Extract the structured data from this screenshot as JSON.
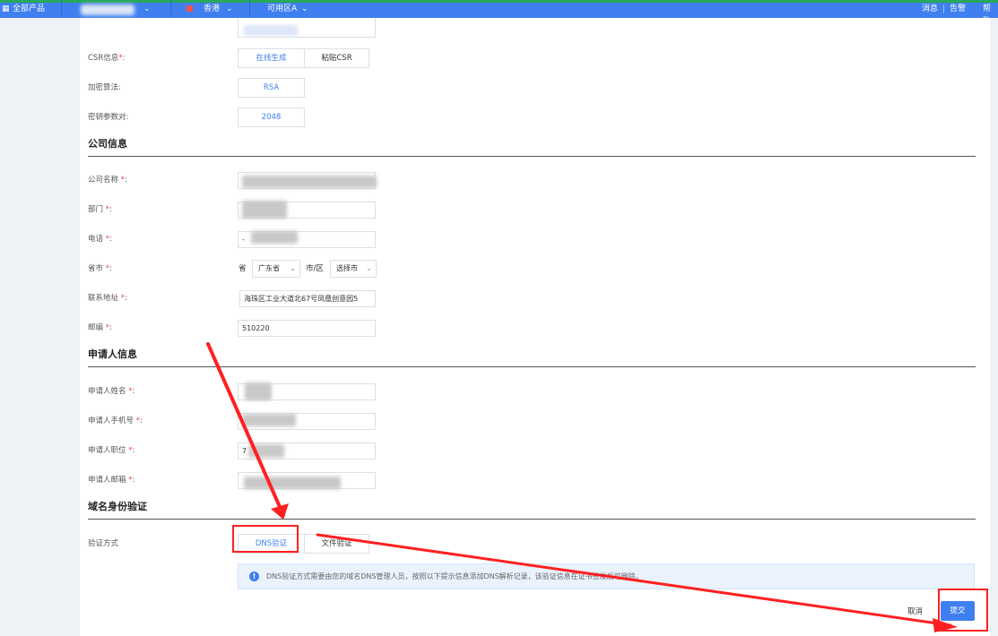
{
  "topbar": {
    "all_products": "全部产品",
    "region": "香港",
    "zone": "可用区A",
    "messages": "消息",
    "alerts": "告警",
    "help": "帮助"
  },
  "csr": {
    "csr_info_label": "CSR信息",
    "online_generate": "在线生成",
    "paste_csr": "粘贴CSR",
    "algorithm_label": "加密算法:",
    "algorithm_value": "RSA",
    "key_pair_label": "密钥参数对:",
    "key_pair_value": "2048"
  },
  "company": {
    "title": "公司信息",
    "name_label": "公司名称",
    "dept_label": "部门",
    "phone_label": "电话",
    "phone_prefix": "-",
    "province_city_label": "省市",
    "province_prefix": "省",
    "province_value": "广东省",
    "city_prefix": "市/区",
    "city_value": "选择市",
    "address_label": "联系地址",
    "address_value": "海珠区工业大道北67号凤凰创意园5",
    "postcode_label": "邮编",
    "postcode_value": "510220"
  },
  "applicant": {
    "title": "申请人信息",
    "name_label": "申请人姓名",
    "mobile_label": "申请人手机号",
    "position_label": "申请人职位",
    "position_prefix": "7",
    "email_label": "申请人邮箱"
  },
  "domain_verify": {
    "title": "域名身份验证",
    "method_label": "验证方式",
    "dns_button": "DNS验证",
    "file_button": "文件验证",
    "info_text": "DNS验证方式需要由您的域名DNS管理人员，按照以下提示信息添加DNS解析记录，该验证信息在证书签发后可删除。"
  },
  "footer": {
    "cancel": "取消",
    "submit": "提交"
  },
  "colors": {
    "accent": "#3f7ff0",
    "annotation": "#ff2020"
  }
}
